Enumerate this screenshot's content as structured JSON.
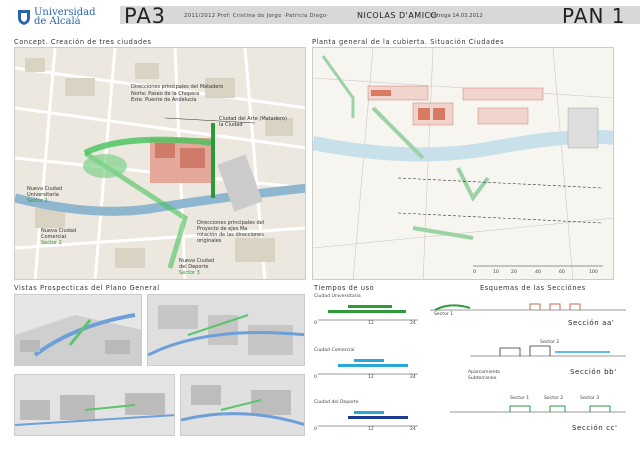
{
  "header": {
    "university_line1": "Universidad",
    "university_line2": "de Alcalá",
    "course": "PA3",
    "meta": "2011/2012  Prof: Cristina de Jorge ·Patricia Diego·",
    "student": "NICOLAS D'AMICO",
    "date": "Entrega 14.03.2012",
    "panel": "PAN 1"
  },
  "sections": {
    "concept_title": "Concept. Creación de tres ciudades",
    "plan_title": "Planta general de la cubierta. Situación Ciudades",
    "views_title": "Vistas Prospecticas del Plano General",
    "times_title": "Tiempos de uso",
    "schemes_title": "Esquemas de las Secciónes"
  },
  "concept_labels": {
    "directions": "Direcciones principales del Matadero",
    "north": "Norte: Paseo de la Chopera",
    "east": "Este: Puente de Andalucía",
    "arts": "Ciudad del Arte (Matadero)",
    "arts2": "la Ciudad",
    "univ1": "Nueva Ciudad",
    "univ2": "Universitaria",
    "univ3": "Sector 1",
    "commerce1": "Nueva Ciudad",
    "commerce2": "Comercial",
    "commerce3": "Sector 2",
    "project1": "Direcciones principales del",
    "project2": "Proyecto de ejes Ma",
    "project3": "rotación de las direcciones",
    "project4": "originales",
    "sport1": "Nueva Ciudad",
    "sport2": "del Deporte",
    "sport3": "Sector 3"
  },
  "plan_scale": [
    "0",
    "10",
    "20",
    "40",
    "60",
    "100"
  ],
  "times": {
    "blocks": [
      {
        "name": "Ciudad Universitaria",
        "color": "#2e9a3a"
      },
      {
        "name": "Ciudad Comercial",
        "color": "#2aa6d9"
      },
      {
        "name": "Ciudad del Deporte",
        "color": "#1d3a8f"
      }
    ],
    "axis": [
      "0",
      "12",
      "24"
    ]
  },
  "schemes": {
    "a_sector": "Sector 1",
    "a_title": "Sección aa'",
    "b_sector": "Sector 2",
    "b_note1": "Aparcamiento",
    "b_note2": "Subterraneo",
    "b_title": "Sección bb'",
    "c_s1": "Sector 1",
    "c_s2": "Sector 2",
    "c_s3": "Sector 3",
    "c_title": "Sección cc'"
  }
}
